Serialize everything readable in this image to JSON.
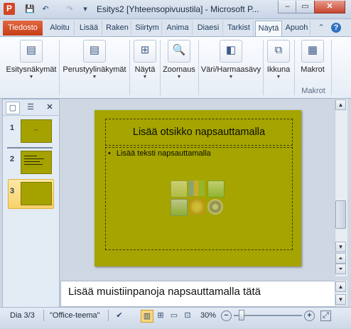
{
  "window": {
    "app_icon": "P",
    "title": "Esitys2 [Yhteensopivuustila]  -  Microsoft P...",
    "controls": {
      "minimize": "–",
      "maximize": "▭",
      "close": "✕"
    }
  },
  "quick_access": {
    "save_icon": "💾",
    "undo_icon": "↶",
    "redo_icon": "↷",
    "customize_icon": "▾"
  },
  "tabs": {
    "file": "Tiedosto",
    "items": [
      "Aloitu",
      "Lisää",
      "Raken",
      "Siirtym",
      "Anima",
      "Diaesi",
      "Tarkist",
      "Näytä",
      "Apuoh"
    ],
    "active": "Näytä"
  },
  "ribbon": {
    "buttons": [
      {
        "label": "Esitysnäkymät",
        "icon": "presentation-views-icon",
        "glyph": "▤"
      },
      {
        "label": "Perustyylinäkymät",
        "icon": "master-views-icon",
        "glyph": "▤"
      },
      {
        "label": "Näytä",
        "icon": "show-icon",
        "glyph": "⊞"
      },
      {
        "label": "Zoomaus",
        "icon": "zoom-icon",
        "glyph": "🔍"
      },
      {
        "label": "Väri/Harmaasävy",
        "icon": "color-grayscale-icon",
        "glyph": "◧"
      },
      {
        "label": "Ikkuna",
        "icon": "window-icon",
        "glyph": "⧉"
      },
      {
        "label": "Makrot",
        "icon": "macros-icon",
        "glyph": "▦"
      }
    ],
    "group_label": "Makrot"
  },
  "slides_panel": {
    "tabs": {
      "slides": "▢",
      "outline": "☰",
      "close": "✕"
    },
    "thumbnails": [
      {
        "number": "1",
        "text": "--"
      },
      {
        "number": "2",
        "text": ""
      },
      {
        "number": "3",
        "text": ""
      }
    ],
    "selected": 3
  },
  "slide": {
    "title_placeholder": "Lisää otsikko napsauttamalla",
    "body_placeholder": "Lisää teksti napsauttamalla",
    "bullet": "•",
    "background_color": "#a5a400"
  },
  "notes": {
    "placeholder": "Lisää muistiinpanoja napsauttamalla tätä"
  },
  "status": {
    "slide_indicator": "Dia 3/3",
    "theme": "\"Office-teema\"",
    "zoom_level": "30%",
    "zoom_minus": "−",
    "zoom_plus": "+",
    "zoom_fraction": 0.3
  },
  "colors": {
    "file_tab": "#c63d17",
    "slide_bg": "#a5a400",
    "selected_thumb": "#f8d16a"
  }
}
